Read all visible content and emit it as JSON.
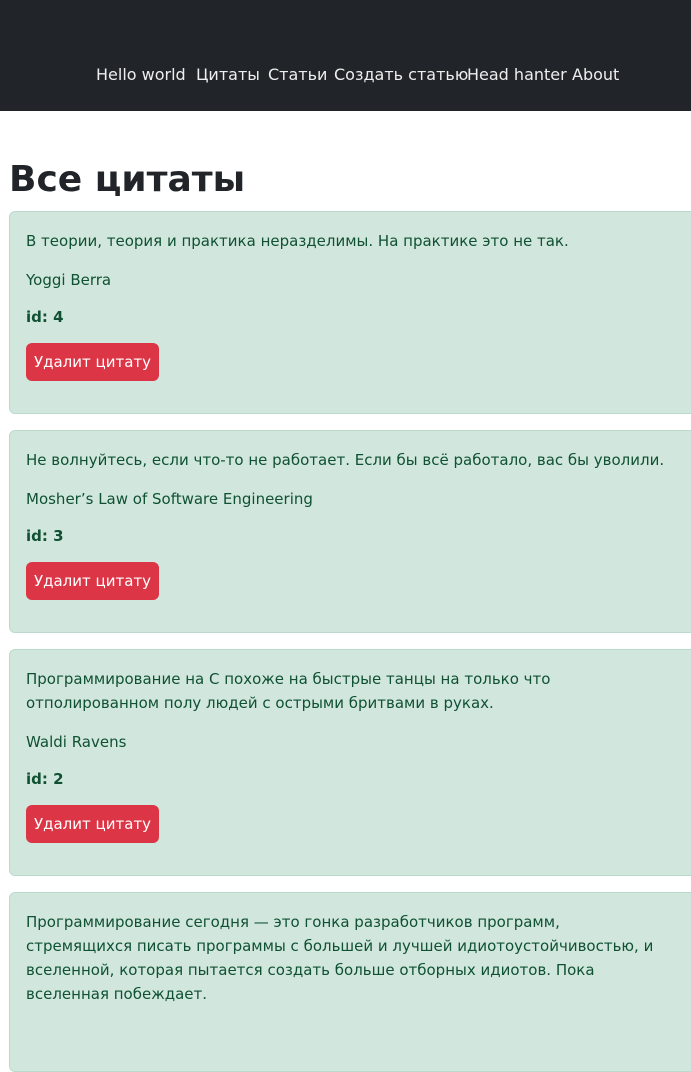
{
  "nav": {
    "items": [
      "Hello world",
      "Цитаты",
      "Статьи",
      "Создать статью",
      "Head hanter",
      "About"
    ]
  },
  "page_title": "Все цитаты",
  "quotes": [
    {
      "text": "В теории, теория и практика неразделимы. На практике это не так.",
      "author": "Yoggi Berra",
      "id": "id: 4",
      "delete_label": "Удалит цитату"
    },
    {
      "text": "Не волнуйтесь, если что-то не работает. Если бы всё работало, вас бы уволили.",
      "author": "Mosher’s Law of Software Engineering",
      "id": "id: 3",
      "delete_label": "Удалит цитату"
    },
    {
      "text": "Программирование на С похоже на быстрые танцы на только что отполированном полу людей с острыми бритвами в руках.",
      "author": "Waldi Ravens",
      "id": "id: 2",
      "delete_label": "Удалит цитату"
    },
    {
      "text": "Программирование сегодня — это гонка разработчиков программ, стремящихся писать программы с большей и лучшей идиотоустойчивостью, и вселенной, которая пытается создать больше отборных идиотов. Пока вселенная побеждает."
    }
  ]
}
